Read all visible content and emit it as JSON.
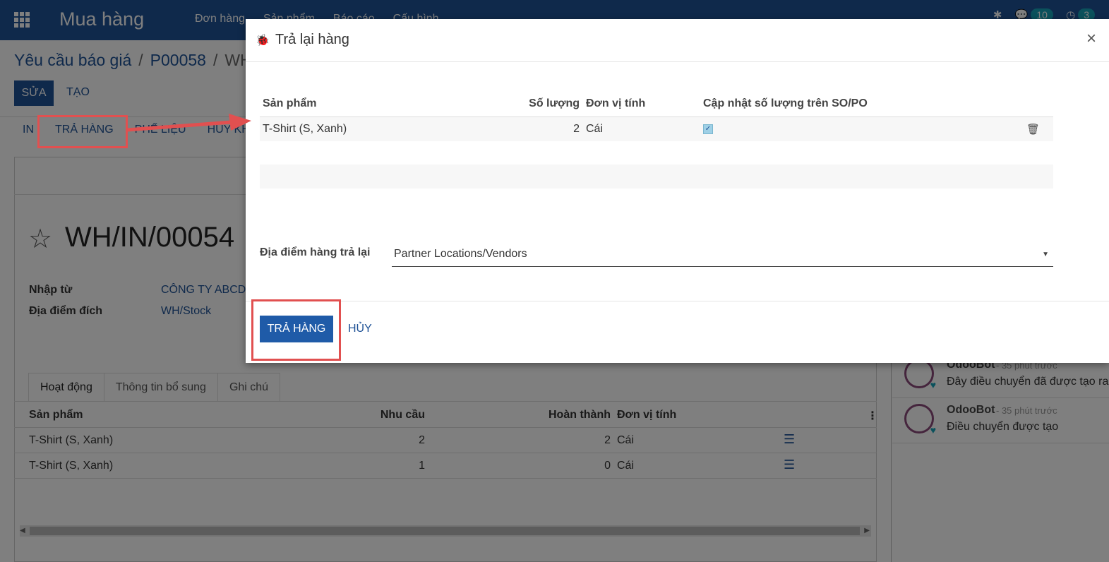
{
  "navbar": {
    "app_title": "Mua hàng",
    "menu": [
      "Đơn hàng",
      "Sản phẩm",
      "Báo cáo",
      "Cấu hình"
    ],
    "messages_count": "10",
    "activities_count": "3",
    "bg_color": "#1f5296"
  },
  "breadcrumb": [
    "Yêu cầu báo giá",
    "P00058",
    "WH/"
  ],
  "control": {
    "edit_label": "SỬA",
    "create_label": "TẠO"
  },
  "actions": [
    "IN",
    "TRẢ HÀNG",
    "PHẾ LIỆU",
    "HỦY KHO"
  ],
  "record": {
    "title": "WH/IN/00054",
    "fields": [
      {
        "label": "Nhập từ",
        "value": "CÔNG TY ABCD"
      },
      {
        "label": "Địa điểm đích",
        "value": "WH/Stock"
      }
    ]
  },
  "tabs": [
    "Hoạt động",
    "Thông tin bổ sung",
    "Ghi chú"
  ],
  "operations": {
    "headers": {
      "product": "Sản phẩm",
      "demand": "Nhu cầu",
      "done": "Hoàn thành",
      "uom": "Đơn vị tính"
    },
    "rows": [
      {
        "product": "T-Shirt (S, Xanh)",
        "demand": "2",
        "done": "2",
        "uom": "Cái"
      },
      {
        "product": "T-Shirt (S, Xanh)",
        "demand": "1",
        "done": "0",
        "uom": "Cái"
      }
    ]
  },
  "chatter": [
    {
      "author": "OdooBot",
      "time": "- 35 phút trước",
      "body": "Đây điều chuyển đã được tạo ra"
    },
    {
      "author": "OdooBot",
      "time": "- 35 phút trước",
      "body": "Điều chuyển được tạo"
    }
  ],
  "modal": {
    "title": "Trả lại hàng",
    "close": "×",
    "headers": {
      "product": "Sản phẩm",
      "qty": "Số lượng",
      "uom": "Đơn vị tính",
      "update": "Cập nhật số lượng trên SO/PO"
    },
    "row": {
      "product": "T-Shirt (S, Xanh)",
      "qty": "2",
      "uom": "Cái",
      "update_checked": true
    },
    "location_label": "Địa điểm hàng trả lại",
    "location_value": "Partner Locations/Vendors",
    "return_button": "TRẢ HÀNG",
    "cancel_button": "HỦY"
  },
  "annotation_color": "#e15050"
}
